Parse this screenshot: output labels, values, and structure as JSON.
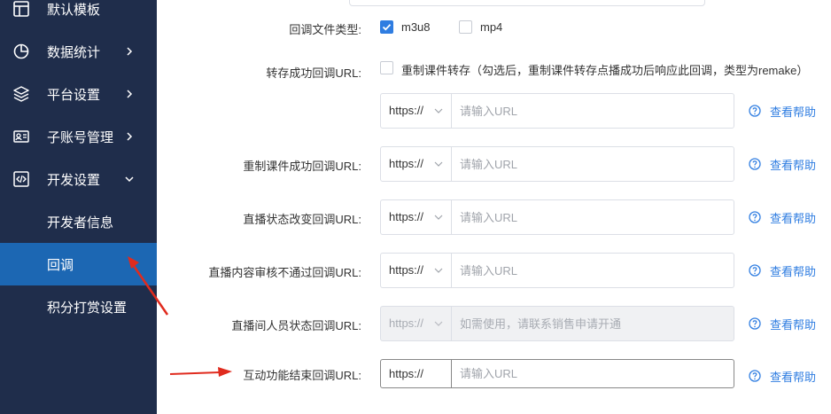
{
  "sidebar": {
    "top_item": "默认模板",
    "items": [
      {
        "label": "数据统计"
      },
      {
        "label": "平台设置"
      },
      {
        "label": "子账号管理"
      },
      {
        "label": "开发设置"
      }
    ],
    "sub_items": [
      {
        "label": "开发者信息"
      },
      {
        "label": "回调"
      },
      {
        "label": "积分打赏设置"
      }
    ]
  },
  "form": {
    "file_type_label": "回调文件类型:",
    "file_type_options": [
      "m3u8",
      "mp4"
    ],
    "file_type_checked": [
      "m3u8"
    ],
    "transfer_label": "转存成功回调URL:",
    "transfer_checkbox_text": "重制课件转存（勾选后，重制课件转存点播成功后响应此回调，类型为remake）",
    "remake_label": "重制课件成功回调URL:",
    "live_status_label": "直播状态改变回调URL:",
    "live_review_label": "直播内容审核不通过回调URL:",
    "member_status_label": "直播间人员状态回调URL:",
    "interactive_end_label": "互动功能结束回调URL:",
    "protocol": "https://",
    "url_placeholder": "请输入URL",
    "disabled_placeholder": "如需使用，请联系销售申请开通",
    "help_label": "查看帮助"
  },
  "colors": {
    "sidebar_bg": "#1f2d4b",
    "active_bg": "#1c67b3",
    "accent": "#2f7de1",
    "arrow": "#e02b1e"
  }
}
